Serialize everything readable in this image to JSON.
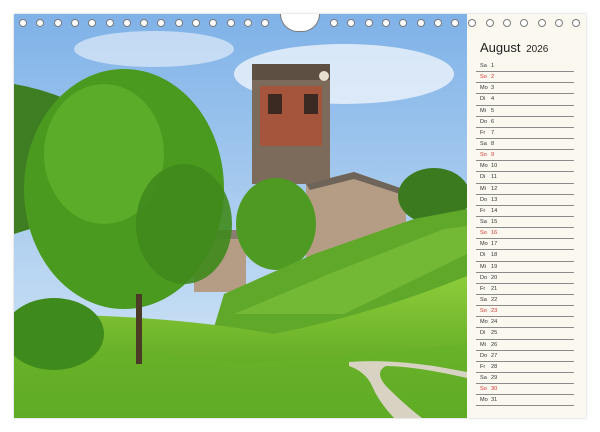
{
  "calendar": {
    "month": "August",
    "year": "2026",
    "days": [
      {
        "wd": "Sa",
        "d": "1"
      },
      {
        "wd": "So",
        "d": "2",
        "sun": true
      },
      {
        "wd": "Mo",
        "d": "3"
      },
      {
        "wd": "Di",
        "d": "4"
      },
      {
        "wd": "Mi",
        "d": "5"
      },
      {
        "wd": "Do",
        "d": "6"
      },
      {
        "wd": "Fr",
        "d": "7"
      },
      {
        "wd": "Sa",
        "d": "8"
      },
      {
        "wd": "So",
        "d": "9",
        "sun": true
      },
      {
        "wd": "Mo",
        "d": "10"
      },
      {
        "wd": "Di",
        "d": "11"
      },
      {
        "wd": "Mi",
        "d": "12"
      },
      {
        "wd": "Do",
        "d": "13"
      },
      {
        "wd": "Fr",
        "d": "14"
      },
      {
        "wd": "Sa",
        "d": "15"
      },
      {
        "wd": "So",
        "d": "16",
        "sun": true
      },
      {
        "wd": "Mo",
        "d": "17"
      },
      {
        "wd": "Di",
        "d": "18"
      },
      {
        "wd": "Mi",
        "d": "19"
      },
      {
        "wd": "Do",
        "d": "20"
      },
      {
        "wd": "Fr",
        "d": "21"
      },
      {
        "wd": "Sa",
        "d": "22"
      },
      {
        "wd": "So",
        "d": "23",
        "sun": true
      },
      {
        "wd": "Mo",
        "d": "24"
      },
      {
        "wd": "Di",
        "d": "25"
      },
      {
        "wd": "Mi",
        "d": "26"
      },
      {
        "wd": "Do",
        "d": "27"
      },
      {
        "wd": "Fr",
        "d": "28"
      },
      {
        "wd": "Sa",
        "d": "29"
      },
      {
        "wd": "So",
        "d": "30",
        "sun": true
      },
      {
        "wd": "Mo",
        "d": "31"
      }
    ]
  },
  "colors": {
    "sunday": "#d0342c",
    "weekday": "#333333",
    "paper": "#fbf8ef"
  },
  "icons": {
    "binding": "spiral-binding-icon",
    "hanger": "hanger-hole-icon"
  }
}
